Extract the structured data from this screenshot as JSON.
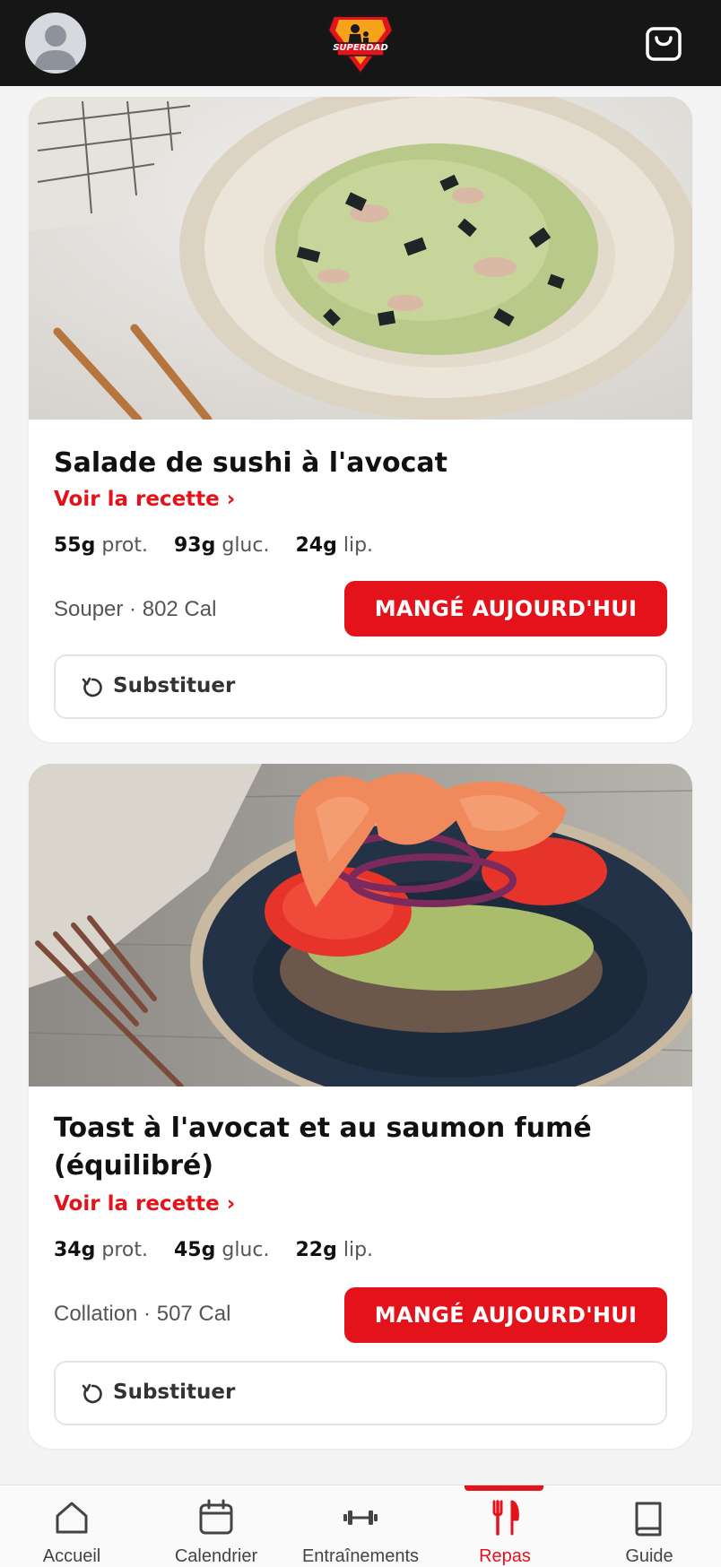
{
  "header": {
    "logo_text": "SUPERDAD"
  },
  "meals": [
    {
      "title": "Salade de sushi à l'avocat",
      "recipe_link": "Voir la recette ›",
      "protein": "55g",
      "protein_unit": "prot.",
      "carbs": "93g",
      "carbs_unit": "gluc.",
      "fat": "24g",
      "fat_unit": "lip.",
      "info": "Souper · 802 Cal",
      "eaten_label": "MANGÉ AUJOURD'HUI",
      "substitute_label": "Substituer"
    },
    {
      "title": "Toast à l'avocat et au saumon fumé (équilibré)",
      "recipe_link": "Voir la recette ›",
      "protein": "34g",
      "protein_unit": "prot.",
      "carbs": "45g",
      "carbs_unit": "gluc.",
      "fat": "22g",
      "fat_unit": "lip.",
      "info": "Collation · 507 Cal",
      "eaten_label": "MANGÉ AUJOURD'HUI",
      "substitute_label": "Substituer"
    }
  ],
  "nav": {
    "items": [
      {
        "label": "Accueil",
        "icon": "home-icon"
      },
      {
        "label": "Calendrier",
        "icon": "calendar-icon"
      },
      {
        "label": "Entraînements",
        "icon": "dumbbell-icon"
      },
      {
        "label": "Repas",
        "icon": "fork-knife-icon",
        "active": true
      },
      {
        "label": "Guide",
        "icon": "book-icon"
      }
    ]
  },
  "colors": {
    "accent": "#e3121b",
    "header_bg": "#161616",
    "page_bg": "#f4f4f4"
  }
}
